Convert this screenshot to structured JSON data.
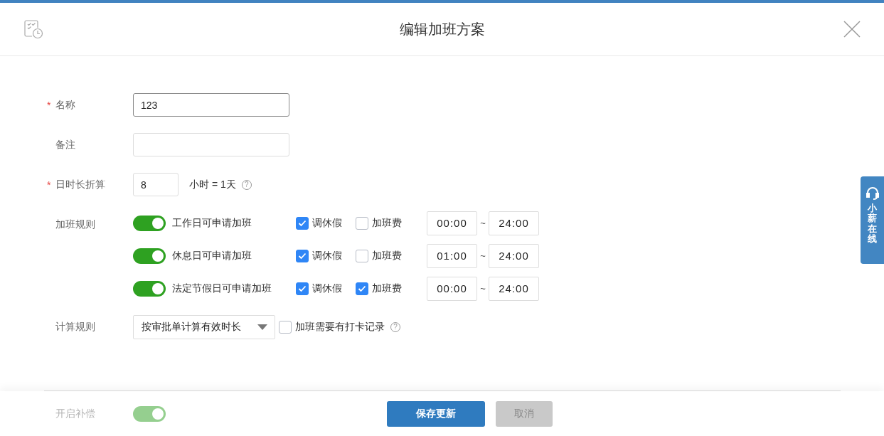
{
  "dialog": {
    "title": "编辑加班方案"
  },
  "fields": [
    {
      "kind": "text",
      "label": "名称",
      "required_mark": "*",
      "value": "123",
      "focused": true
    },
    {
      "kind": "text",
      "label": "备注",
      "focused": false
    },
    {
      "kind": "short",
      "label": "日时长折算",
      "required_mark": "*",
      "value": "8",
      "focused": false,
      "unit": "小时 = 1天",
      "help": "?"
    }
  ],
  "overtime_rules": {
    "label": "加班规则",
    "items": [
      {
        "label": "工作日可申请加班",
        "on": true,
        "options": [
          {
            "label": "调休假",
            "checked": true
          },
          {
            "label": "加班费",
            "checked": false
          }
        ],
        "start": "00:00",
        "separator": "~",
        "end": "24:00"
      },
      {
        "label": "休息日可申请加班",
        "on": true,
        "options": [
          {
            "label": "调休假",
            "checked": true
          },
          {
            "label": "加班费",
            "checked": false
          }
        ],
        "start": "01:00",
        "separator": "~",
        "end": "24:00"
      },
      {
        "label": "法定节假日可申请加班",
        "on": true,
        "options": [
          {
            "label": "调休假",
            "checked": true
          },
          {
            "label": "加班费",
            "checked": true
          }
        ],
        "start": "00:00",
        "separator": "~",
        "end": "24:00"
      }
    ]
  },
  "calculation": {
    "label": "计算规则",
    "select": "按审批单计算有效时长",
    "option": {
      "label": "加班需要有打卡记录",
      "checked": false,
      "help": "?"
    }
  },
  "compensation": {
    "label": "开启补偿",
    "on": true
  },
  "buttons": [
    {
      "label": "保存更新",
      "kind": "primary"
    },
    {
      "label": "取消",
      "kind": "secondary"
    }
  ],
  "side_tab": {
    "label": "小薪在线"
  }
}
